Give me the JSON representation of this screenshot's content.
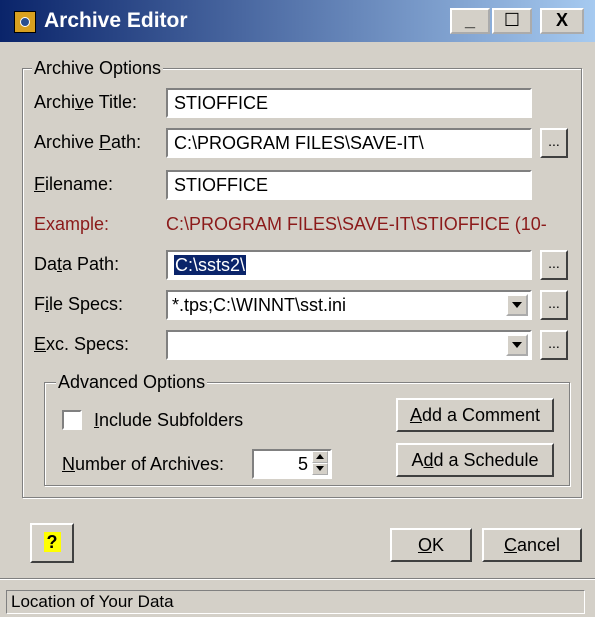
{
  "window": {
    "title": "Archive Editor",
    "minimize_glyph": "_",
    "maximize_glyph": "☐",
    "close_glyph": "X"
  },
  "archive_options": {
    "legend": "Archive Options",
    "title_label": {
      "pre": "Archi",
      "key": "v",
      "post": "e Title:"
    },
    "title_value": "STIOFFICE",
    "path_label": {
      "pre": "Archive ",
      "key": "P",
      "post": "ath:"
    },
    "path_value": "C:\\PROGRAM FILES\\SAVE-IT\\",
    "filename_label": {
      "pre": "",
      "key": "F",
      "post": "ilename:"
    },
    "filename_value": "STIOFFICE",
    "example_label": "Example:",
    "example_value": "C:\\PROGRAM FILES\\SAVE-IT\\STIOFFICE (10-",
    "data_path_label": {
      "pre": "Da",
      "key": "t",
      "post": "a Path:"
    },
    "data_path_value": "C:\\ssts2\\",
    "file_specs_label": {
      "pre": "F",
      "key": "i",
      "post": "le Specs:"
    },
    "file_specs_value": "*.tps;C:\\WINNT\\sst.ini",
    "exc_specs_label": {
      "pre": "",
      "key": "E",
      "post": "xc. Specs:"
    },
    "exc_specs_value": "",
    "browse_label": "..."
  },
  "advanced_options": {
    "legend": "Advanced Options",
    "include_subfolders": {
      "pre": "",
      "key": "I",
      "post": "nclude Subfolders"
    },
    "include_subfolders_checked": false,
    "num_archives_label": {
      "pre": "",
      "key": "N",
      "post": "umber of Archives:"
    },
    "num_archives_value": "5",
    "add_comment": {
      "pre": "",
      "key": "A",
      "post": "dd a Comment"
    },
    "add_schedule": {
      "pre": "A",
      "key": "d",
      "post": "d a Schedule"
    }
  },
  "footer": {
    "help_glyph": "?",
    "ok": {
      "pre": "",
      "key": "O",
      "post": "K"
    },
    "cancel": {
      "pre": "",
      "key": "C",
      "post": "ancel"
    }
  },
  "status_bar": {
    "text": "Location of Your Data"
  },
  "colors": {
    "titlebar_start": "#0a246a",
    "titlebar_end": "#a6caf0",
    "example_text": "#8b1a1a",
    "selection": "#0a246a"
  }
}
